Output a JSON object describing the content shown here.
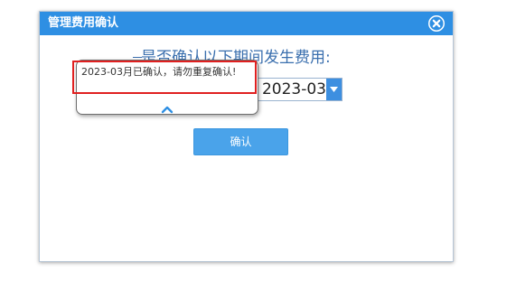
{
  "dialog": {
    "title": "管理费用确认",
    "question": "是否确认以下期间发生费用:",
    "period_value": "2023-03",
    "confirm_label": "确认"
  },
  "tooltip": {
    "message": "2023-03月已确认，请勿重复确认!"
  },
  "colors": {
    "titlebar": "#2e8fe3",
    "question_text": "#3a6fae",
    "confirm_button": "#4aa3ea",
    "highlight": "#e02020"
  },
  "icons": {
    "close": "close-circle-icon",
    "dropdown": "chevron-down-icon",
    "collapse": "chevron-up-icon"
  }
}
